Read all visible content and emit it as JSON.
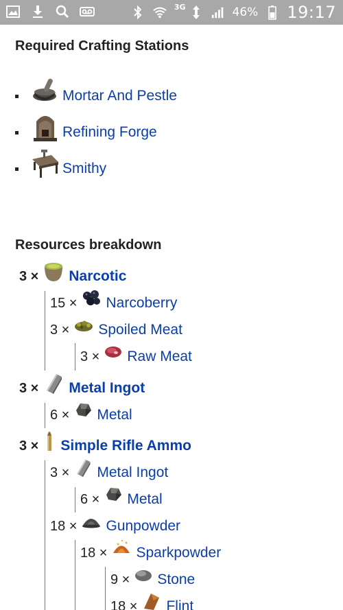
{
  "status_bar": {
    "network": "3G",
    "battery": "46%",
    "time": "19:17"
  },
  "crafting": {
    "heading": "Required Crafting Stations",
    "stations": [
      {
        "label": "Mortar And Pestle",
        "icon": "mortar-icon"
      },
      {
        "label": "Refining Forge",
        "icon": "forge-icon"
      },
      {
        "label": "Smithy",
        "icon": "smithy-icon"
      }
    ]
  },
  "resources": {
    "heading": "Resources breakdown",
    "rows": [
      {
        "qty": "3 ×",
        "label": "Narcotic",
        "icon": "narcotic-icon",
        "bold": true
      },
      {
        "qty": "15 ×",
        "label": "Narcoberry",
        "icon": "berry-icon"
      },
      {
        "qty": "3 ×",
        "label": "Spoiled Meat",
        "icon": "spoiled-meat-icon"
      },
      {
        "qty": "3 ×",
        "label": "Raw Meat",
        "icon": "raw-meat-icon"
      },
      {
        "qty": "3 ×",
        "label": "Metal Ingot",
        "icon": "ingot-icon",
        "bold": true
      },
      {
        "qty": "6 ×",
        "label": "Metal",
        "icon": "metal-icon"
      },
      {
        "qty": "3 ×",
        "label": "Simple Rifle Ammo",
        "icon": "ammo-icon",
        "bold": true
      },
      {
        "qty": "3 ×",
        "label": "Metal Ingot",
        "icon": "ingot-icon"
      },
      {
        "qty": "6 ×",
        "label": "Metal",
        "icon": "metal-icon"
      },
      {
        "qty": "18 ×",
        "label": "Gunpowder",
        "icon": "gunpowder-icon"
      },
      {
        "qty": "18 ×",
        "label": "Sparkpowder",
        "icon": "sparkpowder-icon"
      },
      {
        "qty": "9 ×",
        "label": "Stone",
        "icon": "stone-icon"
      },
      {
        "qty": "18 ×",
        "label": "Flint",
        "icon": "flint-icon"
      }
    ]
  },
  "colors": {
    "link": "#0b3ea8",
    "statusbar": "#a8a8a8"
  }
}
